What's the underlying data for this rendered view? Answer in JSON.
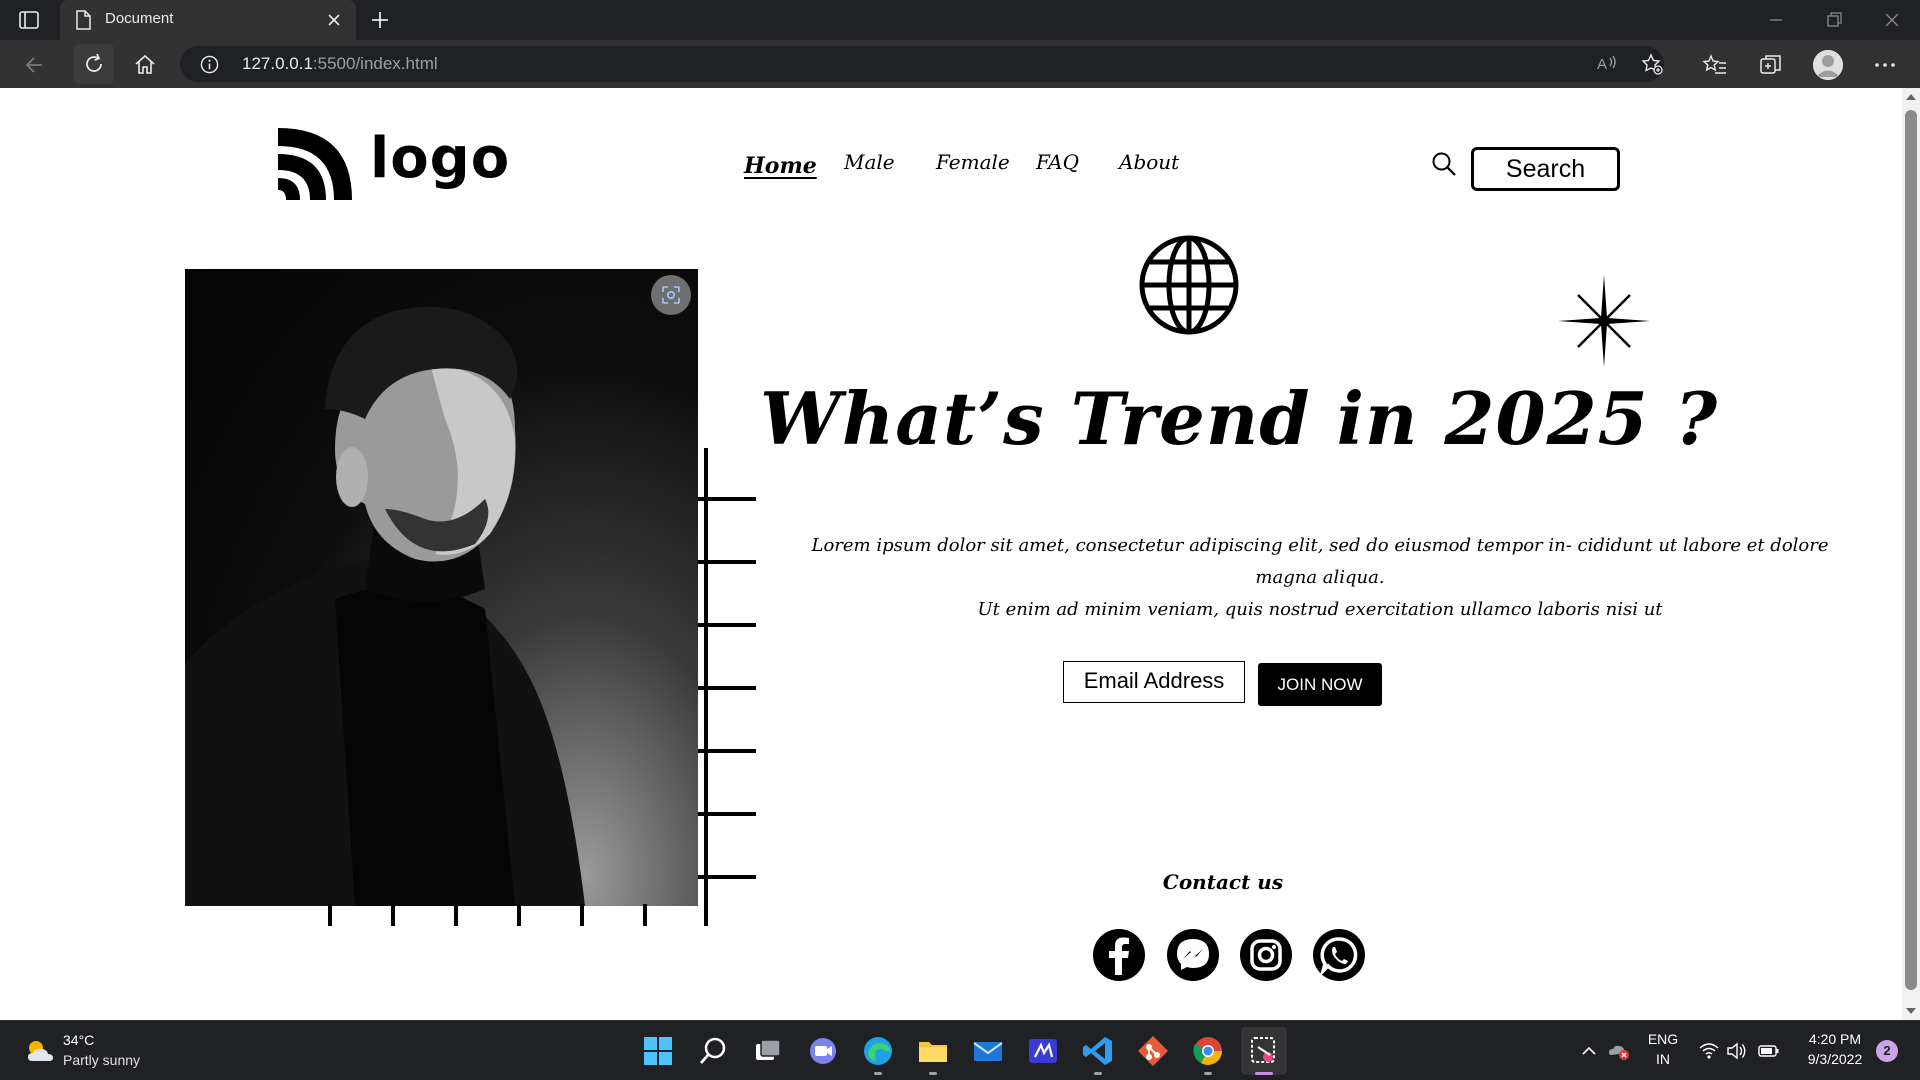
{
  "browser": {
    "tab_title": "Document",
    "url_host": "127.0.0.1",
    "url_rest": ":5500/index.html"
  },
  "page": {
    "logo_text": "logo",
    "nav": [
      "Home",
      "Male",
      "Female",
      "FAQ",
      "About"
    ],
    "search_label": "Search",
    "headline": "What’s Trend in 2025 ?",
    "paragraph_line1": "Lorem ipsum dolor sit amet, consectetur adipiscing elit, sed do eiusmod tempor in- cididunt ut labore et dolore magna aliqua.",
    "paragraph_line2": "Ut enim ad minim veniam, quis nostrud exercitation ullamco laboris nisi ut",
    "email_placeholder": "Email Address",
    "join_label": "JOIN NOW",
    "contact_label": "Contact us",
    "social_icons": [
      "facebook-icon",
      "messenger-icon",
      "instagram-icon",
      "whatsapp-icon"
    ]
  },
  "taskbar": {
    "weather_temp": "34°C",
    "weather_desc": "Partly sunny",
    "lang_top": "ENG",
    "lang_bottom": "IN",
    "time": "4:20 PM",
    "date": "9/3/2022",
    "notification_count": "2"
  },
  "colors": {
    "chrome_dark": "#202124",
    "chrome_mid": "#323232",
    "page_bg": "#ffffff",
    "accent": "#000000"
  }
}
